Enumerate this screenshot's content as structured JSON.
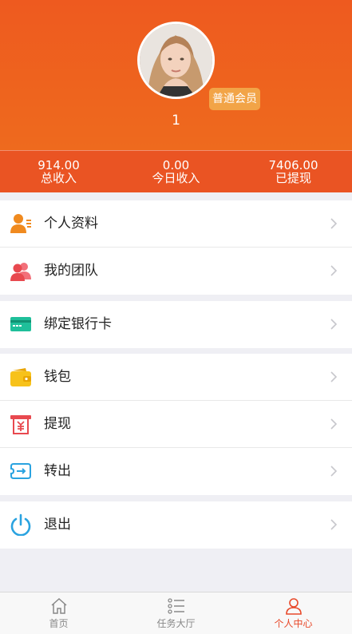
{
  "profile": {
    "badge": "普通会员",
    "username": "1"
  },
  "stats": [
    {
      "value": "914.00",
      "label": "总收入"
    },
    {
      "value": "0.00",
      "label": "今日收入"
    },
    {
      "value": "7406.00",
      "label": "已提现"
    }
  ],
  "menu": {
    "group1": [
      "个人资料",
      "我的团队"
    ],
    "group2": [
      "绑定银行卡"
    ],
    "group3": [
      "钱包",
      "提现",
      "转出"
    ],
    "group4": [
      "退出"
    ]
  },
  "tabbar": {
    "items": [
      {
        "label": "首页",
        "icon": "home-icon"
      },
      {
        "label": "任务大厅",
        "icon": "list-icon"
      },
      {
        "label": "个人中心",
        "icon": "user-icon"
      }
    ],
    "active": "个人中心",
    "active_color": "#e8492a"
  },
  "colors": {
    "header": "#ee5a1f",
    "stats_bar": "#ea5423",
    "badge": "#f2a447"
  }
}
